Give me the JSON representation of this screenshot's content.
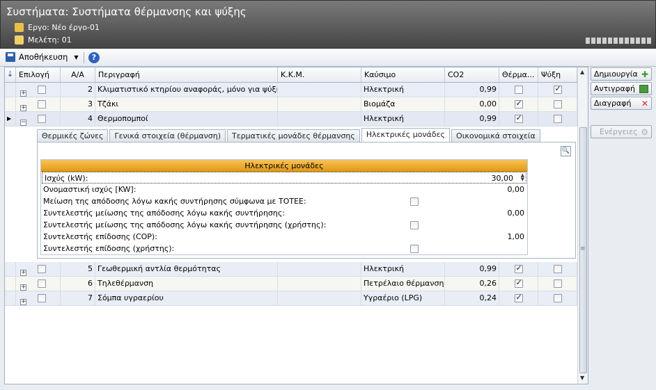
{
  "window": {
    "title": "Συστήματα: Συστήματα θέρμανσης και ψύξης",
    "project_label": "Εργο: Νέο έργο-01",
    "study_label": "Μελέτη: 01"
  },
  "toolbar": {
    "save_label": "Αποθήκευση",
    "help_label": "?"
  },
  "grid": {
    "columns": [
      "Επιλογή",
      "Α/Α",
      "Περιγραφή",
      "Κ.Κ.Μ.",
      "Καύσιμο",
      "CO2",
      "Θέρμα...",
      "Ψύξη"
    ],
    "rows": [
      {
        "aa": "2",
        "desc": "Κλιματιστικό κτηρίου αναφοράς, μόνο για ψύξη",
        "kkm": "",
        "fuel": "Ηλεκτρική",
        "co2": "0,99",
        "heat": false,
        "cool": true
      },
      {
        "aa": "3",
        "desc": "Τζάκι",
        "kkm": "",
        "fuel": "Βιομάζα",
        "co2": "0,00",
        "heat": true,
        "cool": false
      },
      {
        "aa": "4",
        "desc": "Θερμοπομποί",
        "kkm": "",
        "fuel": "Ηλεκτρική",
        "co2": "0,99",
        "heat": true,
        "cool": false
      },
      {
        "aa": "5",
        "desc": "Γεωθερμική αντλία θερμότητας",
        "kkm": "",
        "fuel": "Ηλεκτρική",
        "co2": "0,99",
        "heat": true,
        "cool": false
      },
      {
        "aa": "6",
        "desc": "Τηλεθέρμανση",
        "kkm": "",
        "fuel": "Πετρέλαιο θέρμανσης",
        "co2": "0,26",
        "heat": true,
        "cool": false
      },
      {
        "aa": "7",
        "desc": "Σόμπα υγραερίου",
        "kkm": "",
        "fuel": "Υγραέριο (LPG)",
        "co2": "0,24",
        "heat": true,
        "cool": false
      }
    ]
  },
  "detail": {
    "tabs": [
      "Θερμικές ζώνες",
      "Γενικά στοιχεία (θέρμανση)",
      "Τερματικές μονάδες θέρμανσης",
      "Ηλεκτρικές μονάδες",
      "Οικονομικά στοιχεία"
    ],
    "active_tab": "Ηλεκτρικές μονάδες",
    "section_title": "Ηλεκτρικές μονάδες",
    "fields": [
      {
        "label": "Ισχύς (kW):",
        "value": "30,00"
      },
      {
        "label": "Ονομαστική ισχύς [KW]:",
        "value": "0,00"
      },
      {
        "label": "Μείωση της απόδοσης λόγω κακής συντήρησης σύμφωνα με ΤΟΤΕΕ:",
        "checkbox": false
      },
      {
        "label": "Συντελεστής μείωσης της απόδοσης λόγω κακής συντήρησης:",
        "value": "0,00"
      },
      {
        "label": "Συντελεστής μείωσης της απόδοσης λόγω κακής συντήρησης (χρήστης):",
        "checkbox": false
      },
      {
        "label": "Συντελεστής επίδοσης (COP):",
        "value": "1,00"
      },
      {
        "label": "Συντελεστής επίδοσης (χρήστης):",
        "checkbox": false
      }
    ]
  },
  "actions": {
    "create": "Δημιουργία",
    "copy": "Αντιγραφή",
    "delete": "Διαγραφή",
    "actions": "Ενέργειες"
  },
  "colors": {
    "title_bar": "#5a5a5a",
    "section_header": "#f0a92a",
    "row_alt": "#e9edf5"
  },
  "icons": [
    "project-icon",
    "study-icon",
    "save-icon",
    "help-icon",
    "sort-icon",
    "plus-icon",
    "copy-icon",
    "delete-icon",
    "gear-icon",
    "magnifier-icon"
  ]
}
